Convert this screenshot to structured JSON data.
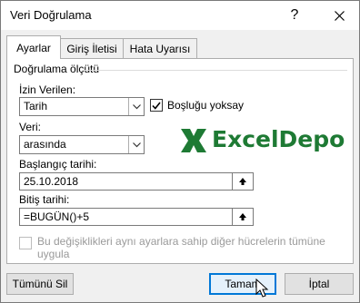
{
  "window": {
    "title": "Veri Doğrulama",
    "help_label": "?",
    "close_label": "✕"
  },
  "tabs": [
    {
      "label": "Ayarlar",
      "active": true
    },
    {
      "label": "Giriş İletisi",
      "active": false
    },
    {
      "label": "Hata Uyarısı",
      "active": false
    }
  ],
  "criteria": {
    "group_title": "Doğrulama ölçütü",
    "allow_label": "İzin Verilen:",
    "allow_value": "Tarih",
    "ignore_blank_label": "Boşluğu yoksay",
    "ignore_blank_checked": true,
    "data_label": "Veri:",
    "data_value": "arasında",
    "start_label": "Başlangıç tarihi:",
    "start_value": "25.10.2018",
    "end_label": "Bitiş tarihi:",
    "end_value": "=BUGÜN()+5",
    "apply_all_label_line1": "Bu değişiklikleri aynı ayarlara sahip diğer hücrelerin tümüne",
    "apply_all_label_line2": "uygula",
    "apply_all_checked": false
  },
  "logo": {
    "text": "ExcelDepo",
    "color": "#1e7a34"
  },
  "buttons": {
    "clear_all": "Tümünü Sil",
    "ok": "Tamam",
    "cancel": "İptal"
  },
  "icons": {
    "dropdown": "chevron-down-icon",
    "range_select": "collapse-range-icon",
    "checkmark": "checkmark-icon",
    "close": "close-icon",
    "logo_mark": "excel-x-icon"
  }
}
